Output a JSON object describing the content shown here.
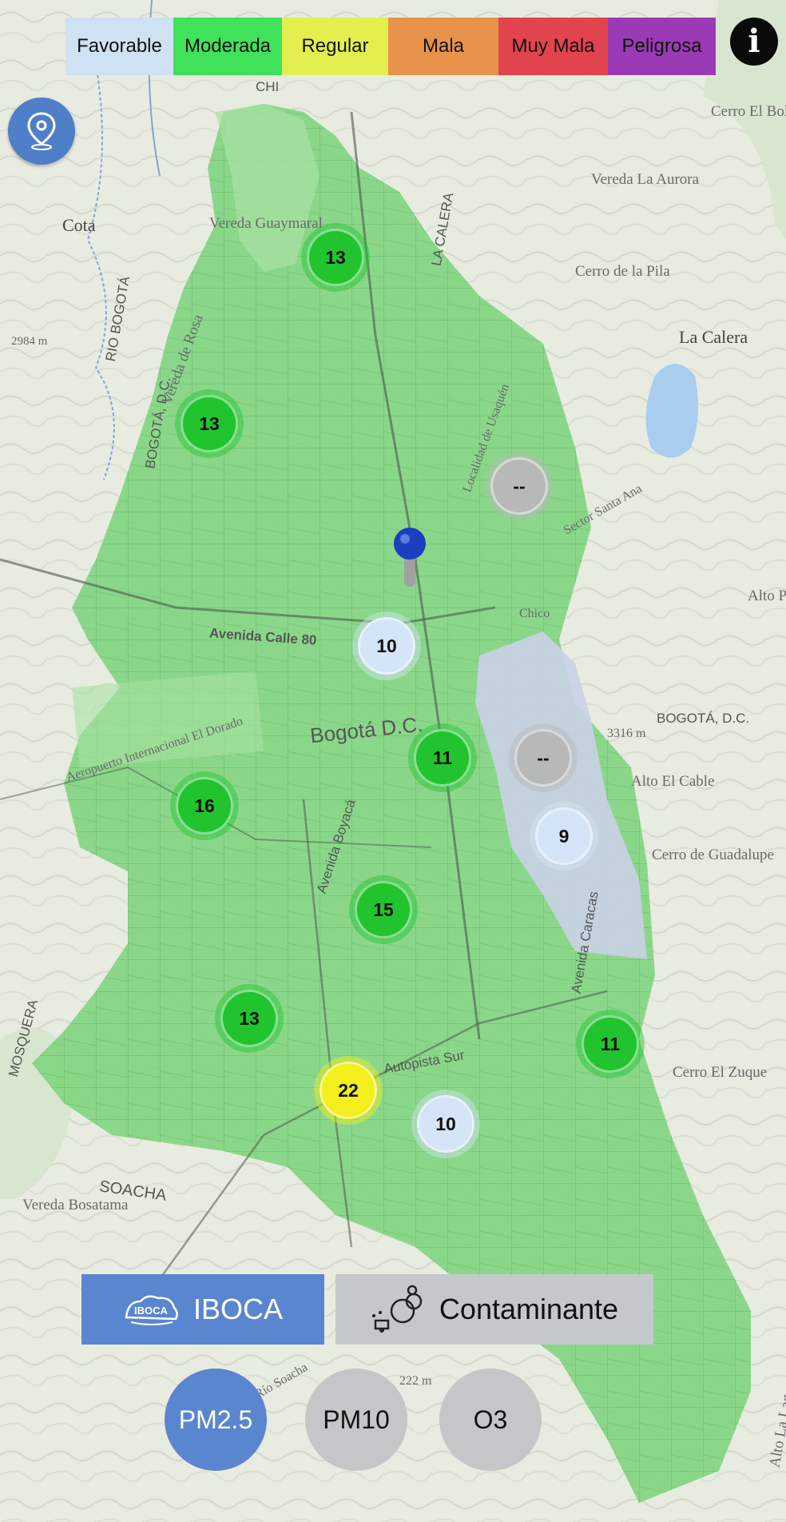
{
  "legend": {
    "items": [
      {
        "label": "Favorable",
        "color": "#cfe2f3"
      },
      {
        "label": "Moderada",
        "color": "#3fe25a"
      },
      {
        "label": "Regular",
        "color": "#e3ef4e"
      },
      {
        "label": "Mala",
        "color": "#e8934b"
      },
      {
        "label": "Muy Mala",
        "color": "#e1444c"
      },
      {
        "label": "Peligrosa",
        "color": "#9a3bb5"
      }
    ]
  },
  "info_icon": "info-icon",
  "locate_icon": "location-pin-icon",
  "map": {
    "city_label": "Bogotá D.C.",
    "place_labels": [
      "Cota",
      "Vereda Guaymaral",
      "Vereda La Aurora",
      "Cerro El Boliche",
      "Cerro de la Pila",
      "La Calera",
      "RIO BOGOTÁ",
      "BOGOTÁ, D.C.",
      "Vereda de Rosa",
      "2984 m",
      "Avenida Calle 80",
      "Aeropuerto Internacional El Dorado",
      "3316 m",
      "BOGOTÁ, D.C.",
      "Alto El Cable",
      "Cerro de Guadalupe",
      "Avenida Boyacá",
      "Autopista Sur",
      "Avenida Caracas",
      "MOSQUERA",
      "SOACHA",
      "Vereda Bosatama",
      "Cerro El Zuque",
      "Alto Pan de",
      "LA CALERA",
      "Localidad de Usaquén",
      "Sector Santa Ana",
      "Chico",
      "CHI",
      "Río Soacha",
      "222 m",
      "Alto La Lag"
    ]
  },
  "stations": [
    {
      "value": "13",
      "status": "moderada",
      "color": "#22c42e"
    },
    {
      "value": "13",
      "status": "moderada",
      "color": "#22c42e"
    },
    {
      "value": "--",
      "status": "sin-datos",
      "color": "#b7b8b9"
    },
    {
      "value": "10",
      "status": "favorable",
      "color": "#d3e5f6"
    },
    {
      "value": "11",
      "status": "moderada",
      "color": "#22c42e"
    },
    {
      "value": "--",
      "status": "sin-datos",
      "color": "#b7b8b9"
    },
    {
      "value": "16",
      "status": "moderada",
      "color": "#22c42e"
    },
    {
      "value": "9",
      "status": "favorable",
      "color": "#d3e5f6"
    },
    {
      "value": "15",
      "status": "moderada",
      "color": "#22c42e"
    },
    {
      "value": "13",
      "status": "moderada",
      "color": "#22c42e"
    },
    {
      "value": "11",
      "status": "moderada",
      "color": "#22c42e"
    },
    {
      "value": "22",
      "status": "regular",
      "color": "#f3ee1d"
    },
    {
      "value": "10",
      "status": "favorable",
      "color": "#d3e5f6"
    }
  ],
  "toggles": {
    "iboca_label": "IBOCA",
    "iboca_logo_text": "IBOCA",
    "contaminante_label": "Contaminante",
    "iboca_active": true
  },
  "pollutants": [
    {
      "label": "PM2.5",
      "selected": true
    },
    {
      "label": "PM10",
      "selected": false
    },
    {
      "label": "O3",
      "selected": false
    }
  ]
}
